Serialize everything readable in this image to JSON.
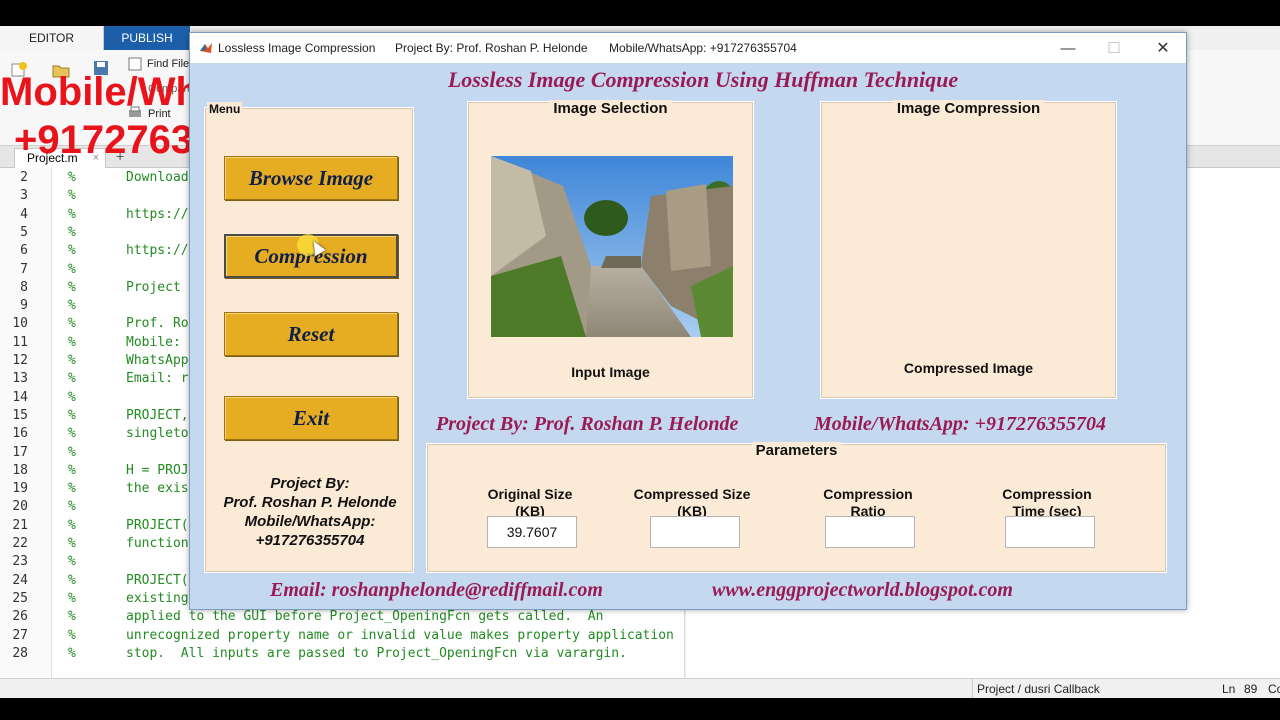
{
  "editor": {
    "tabs": [
      "EDITOR",
      "PUBLISH"
    ],
    "ribbon": {
      "find_files": "Find File",
      "print": "Print",
      "fragments": [
        "New",
        "Open",
        "Save",
        "Compare"
      ]
    },
    "file_tab": "Project.m",
    "file_tab_close": "×",
    "add_tab": "+",
    "code_lines": [
      {
        "n": "2",
        "text": "Download"
      },
      {
        "n": "3",
        "text": ""
      },
      {
        "n": "4",
        "text": "https://"
      },
      {
        "n": "5",
        "text": ""
      },
      {
        "n": "6",
        "text": "https://"
      },
      {
        "n": "7",
        "text": ""
      },
      {
        "n": "8",
        "text": "Project"
      },
      {
        "n": "9",
        "text": ""
      },
      {
        "n": "10",
        "text": "Prof. Ro"
      },
      {
        "n": "11",
        "text": "Mobile:"
      },
      {
        "n": "12",
        "text": "WhatsApp"
      },
      {
        "n": "13",
        "text": "Email: r"
      },
      {
        "n": "14",
        "text": ""
      },
      {
        "n": "15",
        "text": "PROJECT,"
      },
      {
        "n": "16",
        "text": "singleto"
      },
      {
        "n": "17",
        "text": ""
      },
      {
        "n": "18",
        "text": "H = PROJ"
      },
      {
        "n": "19",
        "text": "the exis"
      },
      {
        "n": "20",
        "text": ""
      },
      {
        "n": "21",
        "text": "PROJECT("
      },
      {
        "n": "22",
        "text": "function"
      },
      {
        "n": "23",
        "text": ""
      },
      {
        "n": "24",
        "text": "PROJECT("
      },
      {
        "n": "25",
        "text": "existing"
      },
      {
        "n": "26",
        "text": "applied to the GUI before Project_OpeningFcn gets called.  An"
      },
      {
        "n": "27",
        "text": "unrecognized property name or invalid value makes property application"
      },
      {
        "n": "28",
        "text": "stop.  All inputs are passed to Project_OpeningFcn via varargin."
      }
    ],
    "status": {
      "callback": "Project / dusri Callback",
      "ln_label": "Ln",
      "ln_value": "89",
      "col_label": "Co"
    }
  },
  "watermark": {
    "line1": "Mobile/WhatsApp",
    "line2": "+917276355704"
  },
  "window": {
    "title": "Lossless Image Compression",
    "title_author": "Project By: Prof. Roshan P. Helonde",
    "title_mobile": "Mobile/WhatsApp: +917276355704",
    "minimize": "—",
    "maximize": "☐",
    "close": "✕"
  },
  "gui": {
    "main_title": "Lossless Image Compression Using Huffman Technique",
    "menu": {
      "title": "Menu",
      "browse": "Browse Image",
      "compression": "Compression",
      "reset": "Reset",
      "exit": "Exit",
      "credits": [
        "Project By:",
        "Prof. Roshan P. Helonde",
        "Mobile/WhatsApp:",
        "+917276355704"
      ]
    },
    "image_selection": {
      "title": "Image Selection",
      "label": "Input Image"
    },
    "image_compression": {
      "title": "Image Compression",
      "label": "Compressed Image"
    },
    "author_line": "Project By: Prof. Roshan P. Helonde",
    "mobile_line": "Mobile/WhatsApp: +917276355704",
    "parameters": {
      "title": "Parameters",
      "original_size_label": [
        "Original Size",
        "(KB)"
      ],
      "original_size_value": "39.7607",
      "compressed_size_label": [
        "Compressed Size",
        "(KB)"
      ],
      "compressed_size_value": "",
      "ratio_label": [
        "Compression",
        "Ratio"
      ],
      "ratio_value": "",
      "time_label": [
        "Compression",
        "Time (sec)"
      ],
      "time_value": ""
    },
    "email_line": "Email: roshanphelonde@rediffmail.com",
    "web_line": "www.enggprojectworld.blogspot.com"
  },
  "colors": {
    "accent_text": "#9a1a55",
    "button": "#e6ad23",
    "panel": "#fbebd6",
    "window_bg": "#c4d9ef",
    "watermark": "#e8131b"
  }
}
